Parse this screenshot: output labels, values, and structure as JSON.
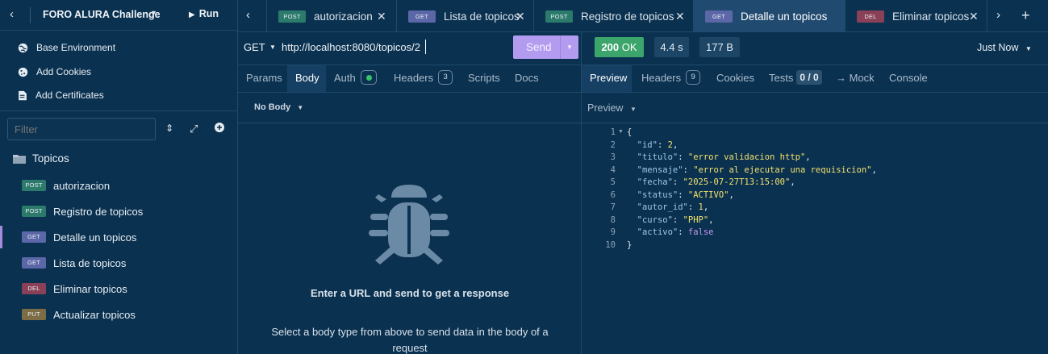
{
  "sidebar": {
    "back_glyph": "‹",
    "project_title": "FORO ALURA Challenge",
    "run_label": "Run",
    "env_items": [
      {
        "label": "Base Environment",
        "icon": "globe-icon"
      },
      {
        "label": "Add Cookies",
        "icon": "cookie-icon"
      },
      {
        "label": "Add Certificates",
        "icon": "certificate-icon"
      }
    ],
    "filter_placeholder": "Filter",
    "folder_label": "Topicos",
    "requests": [
      {
        "method": "POST",
        "name": "autorizacion"
      },
      {
        "method": "POST",
        "name": "Registro de topicos"
      },
      {
        "method": "GET",
        "name": "Detalle un topicos",
        "active": true
      },
      {
        "method": "GET",
        "name": "Lista de topicos"
      },
      {
        "method": "DEL",
        "name": "Eliminar topicos"
      },
      {
        "method": "PUT",
        "name": "Actualizar topicos"
      }
    ]
  },
  "tabs": [
    {
      "method": "POST",
      "name": "autorizacion"
    },
    {
      "method": "GET",
      "name": "Lista de topicos"
    },
    {
      "method": "POST",
      "name": "Registro de topicos"
    },
    {
      "method": "GET",
      "name": "Detalle un topicos",
      "active": true
    },
    {
      "method": "DEL",
      "name": "Eliminar topicos"
    }
  ],
  "request": {
    "method": "GET",
    "url": "http://localhost:8080/topicos/2",
    "send_label": "Send",
    "subtabs": {
      "params": "Params",
      "body": "Body",
      "auth": "Auth",
      "headers": "Headers",
      "headers_count": "3",
      "scripts": "Scripts",
      "docs": "Docs"
    },
    "body_type": "No Body",
    "empty_title": "Enter a URL and send to get a response",
    "empty_desc": "Select a body type from above to send data in the body of a request"
  },
  "response": {
    "status_code": "200",
    "status_text": "OK",
    "time": "4.4 s",
    "size": "177 B",
    "timestamp": "Just Now",
    "subtabs": {
      "preview": "Preview",
      "headers": "Headers",
      "headers_count": "9",
      "cookies": "Cookies",
      "tests": "Tests",
      "tests_count": "0 / 0",
      "mock": "→ Mock",
      "console": "Console"
    },
    "preview_mode": "Preview",
    "json_lines": [
      {
        "n": "1",
        "text": "{"
      },
      {
        "n": "2",
        "key": "\"id\"",
        "value": "2",
        "vtype": "number"
      },
      {
        "n": "3",
        "key": "\"titulo\"",
        "value": "\"error validacion http\"",
        "vtype": "string"
      },
      {
        "n": "4",
        "key": "\"mensaje\"",
        "value": "\"error al ejecutar una requisicion\"",
        "vtype": "string"
      },
      {
        "n": "5",
        "key": "\"fecha\"",
        "value": "\"2025-07-27T13:15:00\"",
        "vtype": "string"
      },
      {
        "n": "6",
        "key": "\"status\"",
        "value": "\"ACTIVO\"",
        "vtype": "string"
      },
      {
        "n": "7",
        "key": "\"autor_id\"",
        "value": "1",
        "vtype": "number"
      },
      {
        "n": "8",
        "key": "\"curso\"",
        "value": "\"PHP\"",
        "vtype": "string"
      },
      {
        "n": "9",
        "key": "\"activo\"",
        "value": "false",
        "vtype": "bool",
        "last": true
      },
      {
        "n": "10",
        "text": "}"
      }
    ]
  },
  "colors": {
    "background": "#0b3150",
    "accent": "#b39cf0",
    "success": "#3ba56b",
    "post": "#2c7a6b",
    "get": "#5c67a8",
    "del": "#8a4057",
    "put": "#7c6d44"
  }
}
